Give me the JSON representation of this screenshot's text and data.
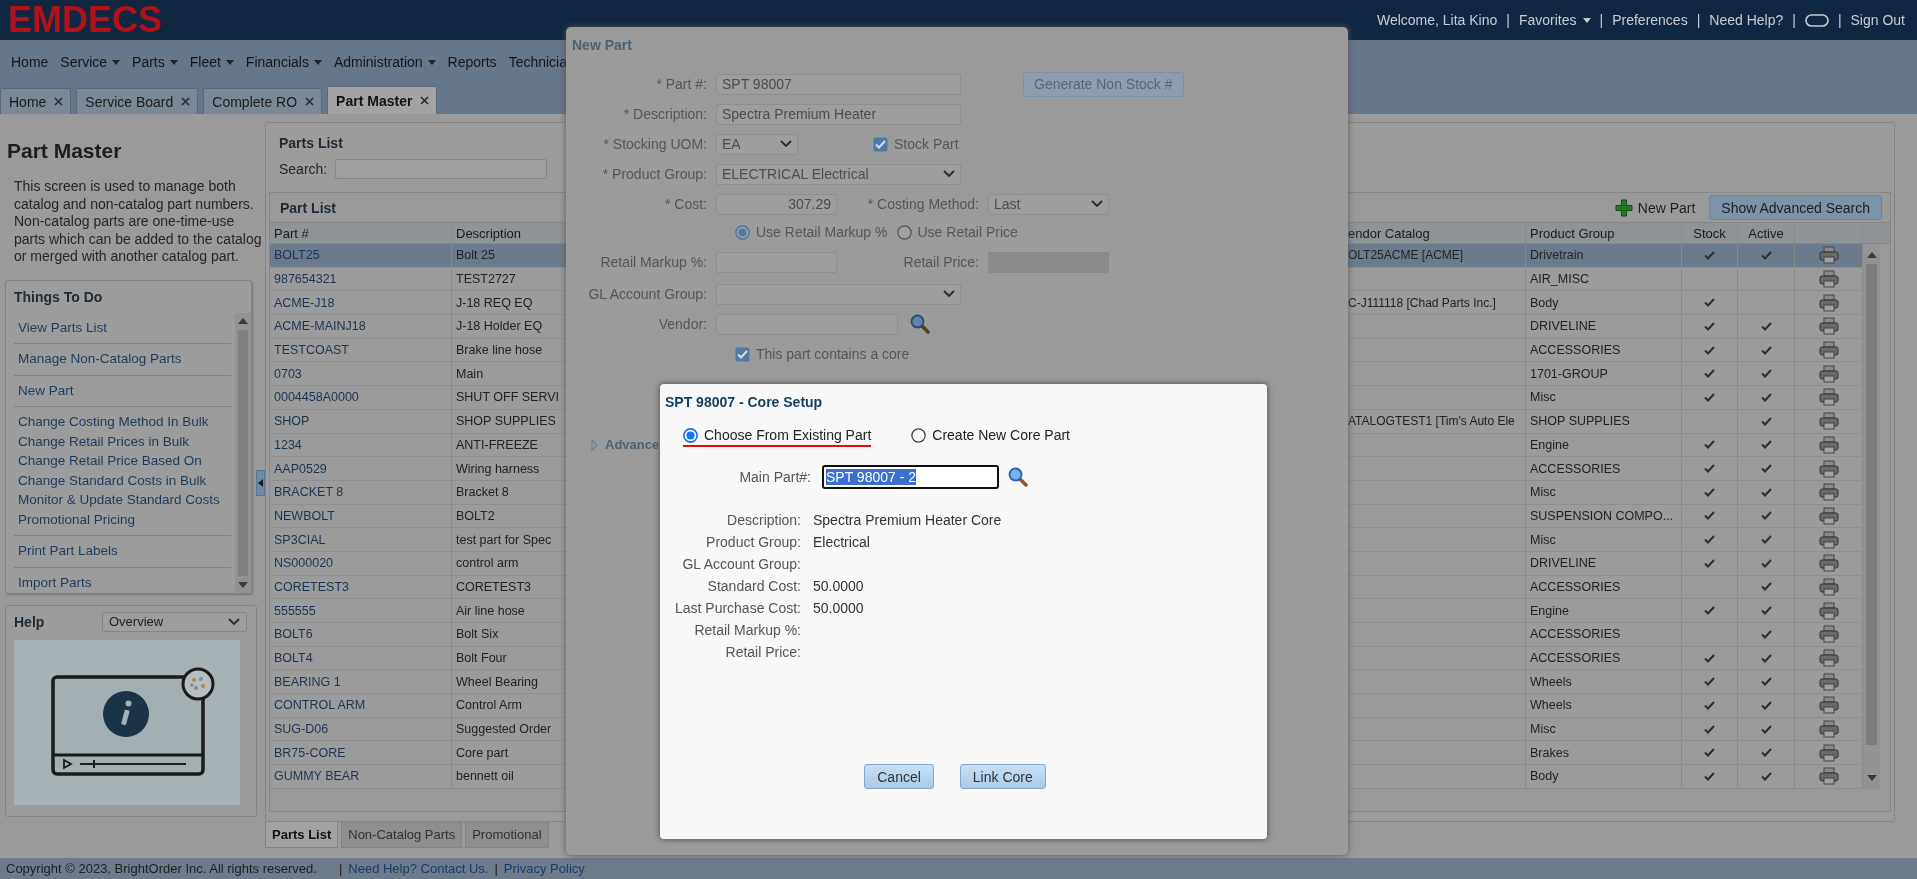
{
  "header": {
    "logo": "EMDECS",
    "separator": "|",
    "user_links": [
      {
        "kind": "text",
        "label": "Welcome, Lita Kino"
      },
      {
        "kind": "menu",
        "label": "Favorites"
      },
      {
        "kind": "link",
        "label": "Preferences"
      },
      {
        "kind": "link",
        "label": "Need Help?"
      },
      {
        "kind": "chat"
      },
      {
        "kind": "link",
        "label": "Sign Out"
      }
    ]
  },
  "menu": [
    {
      "label": "Home",
      "dropdown": false
    },
    {
      "label": "Service",
      "dropdown": true
    },
    {
      "label": "Parts",
      "dropdown": true
    },
    {
      "label": "Fleet",
      "dropdown": true
    },
    {
      "label": "Financials",
      "dropdown": true
    },
    {
      "label": "Administration",
      "dropdown": true
    },
    {
      "label": "Reports",
      "dropdown": false
    },
    {
      "label": "Technicia",
      "dropdown": false
    }
  ],
  "tabs": [
    {
      "label": "Home",
      "selected": false
    },
    {
      "label": "Service Board",
      "selected": false
    },
    {
      "label": "Complete RO",
      "selected": false
    },
    {
      "label": "Part Master",
      "selected": true
    }
  ],
  "sidebar": {
    "title": "Part Master",
    "intro": "This screen is used to manage both catalog and non-catalog part numbers. Non-catalog parts are one-time-use parts which can be added to the catalog or merged with another catalog part.",
    "things_to_do": {
      "title": "Things To Do",
      "groups": [
        [
          "View Parts List"
        ],
        [
          "Manage Non-Catalog Parts"
        ],
        [
          "New Part"
        ],
        [
          "Change Costing Method In Bulk",
          "Change Retail Prices in Bulk",
          "Change Retail Price Based On",
          "Change Standard Costs in Bulk",
          "Monitor & Update Standard Costs",
          "Promotional Pricing"
        ],
        [
          "Print Part Labels"
        ],
        [
          "Import Parts"
        ]
      ]
    },
    "help": {
      "title": "Help",
      "topic": "Overview"
    }
  },
  "parts_list": {
    "title": "Parts List",
    "search_label": "Search:",
    "grid": {
      "title": "Part List",
      "new_part": "New Part",
      "advanced_search": "Show Advanced Search",
      "columns": [
        "Part #",
        "Description",
        "endor Catalog",
        "Product Group",
        "Stock",
        "Active"
      ],
      "rows": [
        {
          "part_no": "BOLT25",
          "description": "Bolt 25",
          "vendor_catalog": "OLT25ACME [ACME]",
          "product_group": "Drivetrain",
          "stock": true,
          "active": true,
          "selected": true
        },
        {
          "part_no": "987654321",
          "description": "TEST2727",
          "product_group": "AIR_MISC",
          "stock": false,
          "active": false,
          "selected": false
        },
        {
          "part_no": "ACME-J18",
          "description": "J-18 REQ EQ",
          "vendor_catalog": "C-J111118 [Chad Parts Inc.]",
          "product_group": "Body",
          "stock": true,
          "active": false,
          "selected": false
        },
        {
          "part_no": "ACME-MAINJ18",
          "description": "J-18 Holder EQ",
          "product_group": "DRIVELINE",
          "stock": true,
          "active": true,
          "selected": false
        },
        {
          "part_no": "TESTCOAST",
          "description": "Brake line hose",
          "product_group": "ACCESSORIES",
          "stock": true,
          "active": true,
          "selected": false
        },
        {
          "part_no": "0703",
          "description": "Main",
          "product_group": "1701-GROUP",
          "stock": true,
          "active": true,
          "selected": false
        },
        {
          "part_no": "0004458A0000",
          "description": "SHUT OFF SERVI",
          "product_group": "Misc",
          "stock": true,
          "active": true,
          "selected": false
        },
        {
          "part_no": "SHOP",
          "description": "SHOP SUPPLIES",
          "vendor_catalog": "ATALOGTEST1 [Tim's Auto Ele",
          "product_group": "SHOP SUPPLIES",
          "stock": false,
          "active": true,
          "selected": false
        },
        {
          "part_no": "1234",
          "description": "ANTI-FREEZE",
          "product_group": "Engine",
          "stock": true,
          "active": true,
          "selected": false
        },
        {
          "part_no": "AAP0529",
          "description": "Wiring harness",
          "product_group": "ACCESSORIES",
          "stock": true,
          "active": true,
          "selected": false
        },
        {
          "part_no": "BRACKET 8",
          "description": "Bracket 8",
          "product_group": "Misc",
          "stock": true,
          "active": true,
          "selected": false
        },
        {
          "part_no": "NEWBOLT",
          "description": "BOLT2",
          "product_group": "SUSPENSION COMPO...",
          "stock": true,
          "active": true,
          "selected": false
        },
        {
          "part_no": "SP3CIAL",
          "description": "test part for Spec",
          "product_group": "Misc",
          "stock": true,
          "active": true,
          "selected": false
        },
        {
          "part_no": "NS000020",
          "description": "control arm",
          "product_group": "DRIVELINE",
          "stock": true,
          "active": true,
          "selected": false
        },
        {
          "part_no": "CORETEST3",
          "description": "CORETEST3",
          "product_group": "ACCESSORIES",
          "stock": false,
          "active": true,
          "selected": false
        },
        {
          "part_no": "555555",
          "description": "Air line hose",
          "product_group": "Engine",
          "stock": true,
          "active": true,
          "selected": false
        },
        {
          "part_no": "BOLT6",
          "description": "Bolt Six",
          "product_group": "ACCESSORIES",
          "stock": false,
          "active": true,
          "selected": false
        },
        {
          "part_no": "BOLT4",
          "description": "Bolt Four",
          "product_group": "ACCESSORIES",
          "stock": true,
          "active": true,
          "selected": false
        },
        {
          "part_no": "BEARING 1",
          "description": "Wheel Bearing",
          "product_group": "Wheels",
          "stock": true,
          "active": true,
          "selected": false
        },
        {
          "part_no": "CONTROL ARM",
          "description": "Control Arm",
          "product_group": "Wheels",
          "stock": true,
          "active": true,
          "selected": false
        },
        {
          "part_no": "SUG-D06",
          "description": "Suggested Order",
          "product_group": "Misc",
          "stock": true,
          "active": true,
          "selected": false
        },
        {
          "part_no": "BR75-CORE",
          "description": "Core part",
          "product_group": "Brakes",
          "stock": true,
          "active": true,
          "selected": false
        },
        {
          "part_no": "GUMMY BEAR",
          "description": "bennett oil",
          "product_group": "Body",
          "stock": true,
          "active": true,
          "selected": false
        }
      ]
    },
    "bottom_tabs": [
      {
        "label": "Parts List",
        "selected": true
      },
      {
        "label": "Non-Catalog Parts",
        "selected": false
      },
      {
        "label": "Promotional",
        "selected": false
      }
    ]
  },
  "new_part_dialog": {
    "title": "New Part",
    "part_no": {
      "label": "* Part #:",
      "value": "SPT 98007"
    },
    "generate_button": "Generate Non Stock #",
    "description": {
      "label": "* Description:",
      "value": "Spectra Premium Heater"
    },
    "stocking_uom": {
      "label": "* Stocking UOM:",
      "value": "EA"
    },
    "stock_part": {
      "label": "Stock Part",
      "checked": true
    },
    "product_group": {
      "label": "* Product Group:",
      "value": "ELECTRICAL Electrical"
    },
    "cost": {
      "label": "* Cost:",
      "value": "307.29"
    },
    "costing_method": {
      "label": "* Costing Method:",
      "value": "Last"
    },
    "pricing_options": [
      {
        "label": "Use Retail Markup %",
        "selected": true
      },
      {
        "label": "Use Retail Price",
        "selected": false
      }
    ],
    "retail_markup": {
      "label": "Retail Markup %:"
    },
    "retail_price": {
      "label": "Retail Price:",
      "disabled": true
    },
    "gl_account_group": {
      "label": "GL Account Group:"
    },
    "vendor": {
      "label": "Vendor:"
    },
    "contains_core": {
      "label": "This part contains a core",
      "checked": true
    },
    "advanced": "Advance"
  },
  "core_setup_dialog": {
    "title": "SPT 98007 - Core Setup",
    "options": [
      {
        "label": "Choose From Existing Part",
        "selected": true,
        "underlined": true
      },
      {
        "label": "Create New Core Part",
        "selected": false,
        "underlined": false
      }
    ],
    "main_part": {
      "label": "Main Part#:",
      "value": "SPT 98007 - 2",
      "value_selected": true
    },
    "details": [
      {
        "label": "Description:",
        "value": "Spectra Premium Heater Core"
      },
      {
        "label": "Product Group:",
        "value": "Electrical"
      },
      {
        "label": "GL Account Group:"
      },
      {
        "label": "Standard Cost:",
        "value": "50.0000"
      },
      {
        "label": "Last Purchase Cost:",
        "value": "50.0000"
      },
      {
        "label": "Retail Markup %:"
      },
      {
        "label": "Retail Price:"
      }
    ],
    "buttons": [
      "Cancel",
      "Link Core"
    ]
  },
  "footer": {
    "copyright": "Copyright © 2023, BrightOrder Inc. All rights reserved.",
    "separator": "|",
    "links": [
      "Need Help? Contact Us.",
      "Privacy Policy"
    ]
  }
}
